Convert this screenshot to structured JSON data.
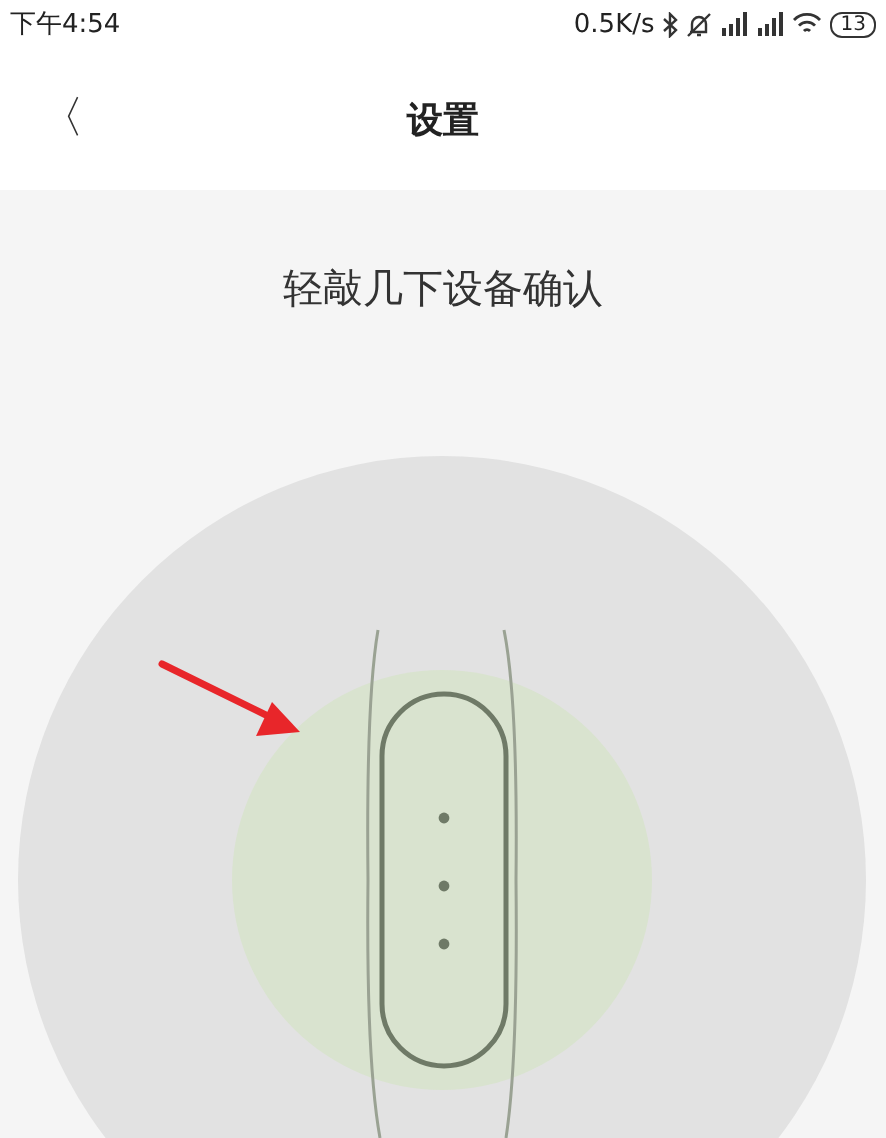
{
  "status_bar": {
    "time": "下午4:54",
    "net_speed": "0.5K/s",
    "battery": "13"
  },
  "header": {
    "back": "〈",
    "title": "设置"
  },
  "instruction": "轻敲几下设备确认"
}
